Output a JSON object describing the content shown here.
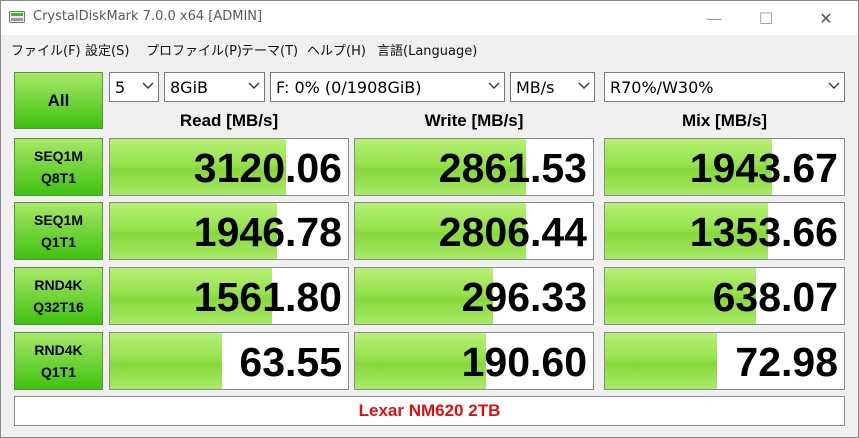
{
  "window": {
    "title": "CrystalDiskMark 7.0.0 x64 [ADMIN]",
    "minimize_glyph": "—",
    "maximize_glyph": "☐",
    "close_glyph": "✕"
  },
  "menu": [
    "ファイル(F)",
    "設定(S)",
    "プロファイル(P)",
    "テーマ(T)",
    "ヘルプ(H)",
    "言語(Language)"
  ],
  "controls": {
    "all_label": "All",
    "count": "5",
    "size": "8GiB",
    "drive": "F: 0% (0/1908GiB)",
    "unit": "MB/s",
    "mix_ratio": "R70%/W30%"
  },
  "headers": {
    "read": "Read [MB/s]",
    "write": "Write [MB/s]",
    "mix": "Mix [MB/s]"
  },
  "tests": [
    {
      "line1": "SEQ1M",
      "line2": "Q8T1",
      "read": "3120.06",
      "write": "2861.53",
      "mix": "1943.67",
      "read_fill": 0.74,
      "write_fill": 0.72,
      "mix_fill": 0.7
    },
    {
      "line1": "SEQ1M",
      "line2": "Q1T1",
      "read": "1946.78",
      "write": "2806.44",
      "mix": "1353.66",
      "read_fill": 0.7,
      "write_fill": 0.72,
      "mix_fill": 0.68
    },
    {
      "line1": "RND4K",
      "line2": "Q32T16",
      "read": "1561.80",
      "write": "296.33",
      "mix": "638.07",
      "read_fill": 0.68,
      "write_fill": 0.58,
      "mix_fill": 0.63
    },
    {
      "line1": "RND4K",
      "line2": "Q1T1",
      "read": "63.55",
      "write": "190.60",
      "mix": "72.98",
      "read_fill": 0.47,
      "write_fill": 0.55,
      "mix_fill": 0.47
    }
  ],
  "comment": "Lexar NM620 2TB",
  "colors": {
    "accent_green": "#3dc20f",
    "bar_green": "#96e24d",
    "comment_red": "#e01010"
  }
}
